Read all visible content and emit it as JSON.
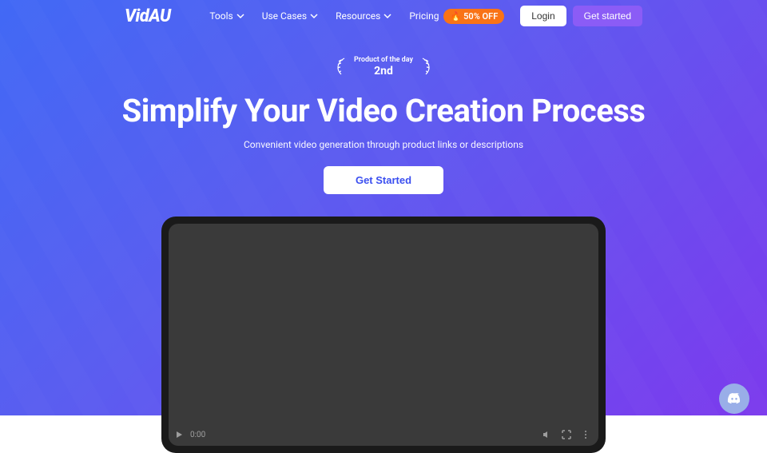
{
  "header": {
    "logo": "VidAU",
    "nav": [
      {
        "label": "Tools",
        "hasDropdown": true
      },
      {
        "label": "Use Cases",
        "hasDropdown": true
      },
      {
        "label": "Resources",
        "hasDropdown": true
      }
    ],
    "pricing_label": "Pricing",
    "discount_badge": "50% OFF",
    "login_label": "Login",
    "getstarted_label": "Get started"
  },
  "hero": {
    "award_top": "Product of the day",
    "award_rank": "2nd",
    "headline": "Simplify Your Video Creation Process",
    "subheadline": "Convenient video generation through product links or descriptions",
    "cta_label": "Get Started"
  },
  "video": {
    "time": "0:00"
  }
}
